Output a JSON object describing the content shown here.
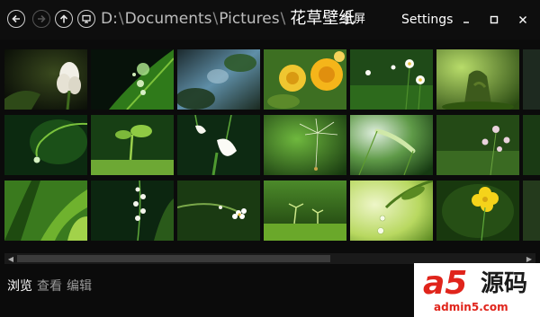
{
  "toolbar": {
    "back_icon": "back-arrow-icon",
    "forward_icon": "forward-arrow-icon",
    "up_icon": "up-arrow-icon",
    "view_icon": "monitor-icon",
    "path_segments": [
      "D:",
      "Documents",
      "Pictures"
    ],
    "path_separator": "\\",
    "folder_name": "花草壁纸",
    "fullscreen_label": "全屏",
    "settings_label": "Settings",
    "minimize_icon": "minimize-icon",
    "maximize_icon": "maximize-icon",
    "close_icon": "close-icon"
  },
  "gallery": {
    "thumbnails": [
      {
        "subject": "white-flower-bud"
      },
      {
        "subject": "water-droplets-on-leaf"
      },
      {
        "subject": "blurred-leaves-blue"
      },
      {
        "subject": "yellow-roses"
      },
      {
        "subject": "white-daisies"
      },
      {
        "subject": "tree-stump-green"
      },
      {
        "subject": "dark-edge"
      },
      {
        "subject": "bent-stem-drop"
      },
      {
        "subject": "sprout-seedling"
      },
      {
        "subject": "snowdrop-bells"
      },
      {
        "subject": "dandelion-seed"
      },
      {
        "subject": "grass-seed-head"
      },
      {
        "subject": "pink-small-flowers"
      },
      {
        "subject": "dark-edge"
      },
      {
        "subject": "green-grass-blades"
      },
      {
        "subject": "lily-of-the-valley"
      },
      {
        "subject": "white-flower-branch"
      },
      {
        "subject": "moss-sprouts"
      },
      {
        "subject": "leaf-water-drops"
      },
      {
        "subject": "yellow-buttercup"
      },
      {
        "subject": "dark-edge"
      }
    ]
  },
  "scrollbar": {
    "position": 0.62
  },
  "bottom_tabs": [
    {
      "label": "浏览",
      "active": true
    },
    {
      "label": "查看",
      "active": false
    },
    {
      "label": "编辑",
      "active": false
    }
  ],
  "watermark": {
    "logo_text": "a5",
    "cn_text": "源码",
    "url": "admin5.com"
  },
  "colors": {
    "background": "#0b0b0b",
    "title_text": "#ffffff",
    "path_text": "#bdbdbd",
    "watermark_red": "#e0241b"
  }
}
